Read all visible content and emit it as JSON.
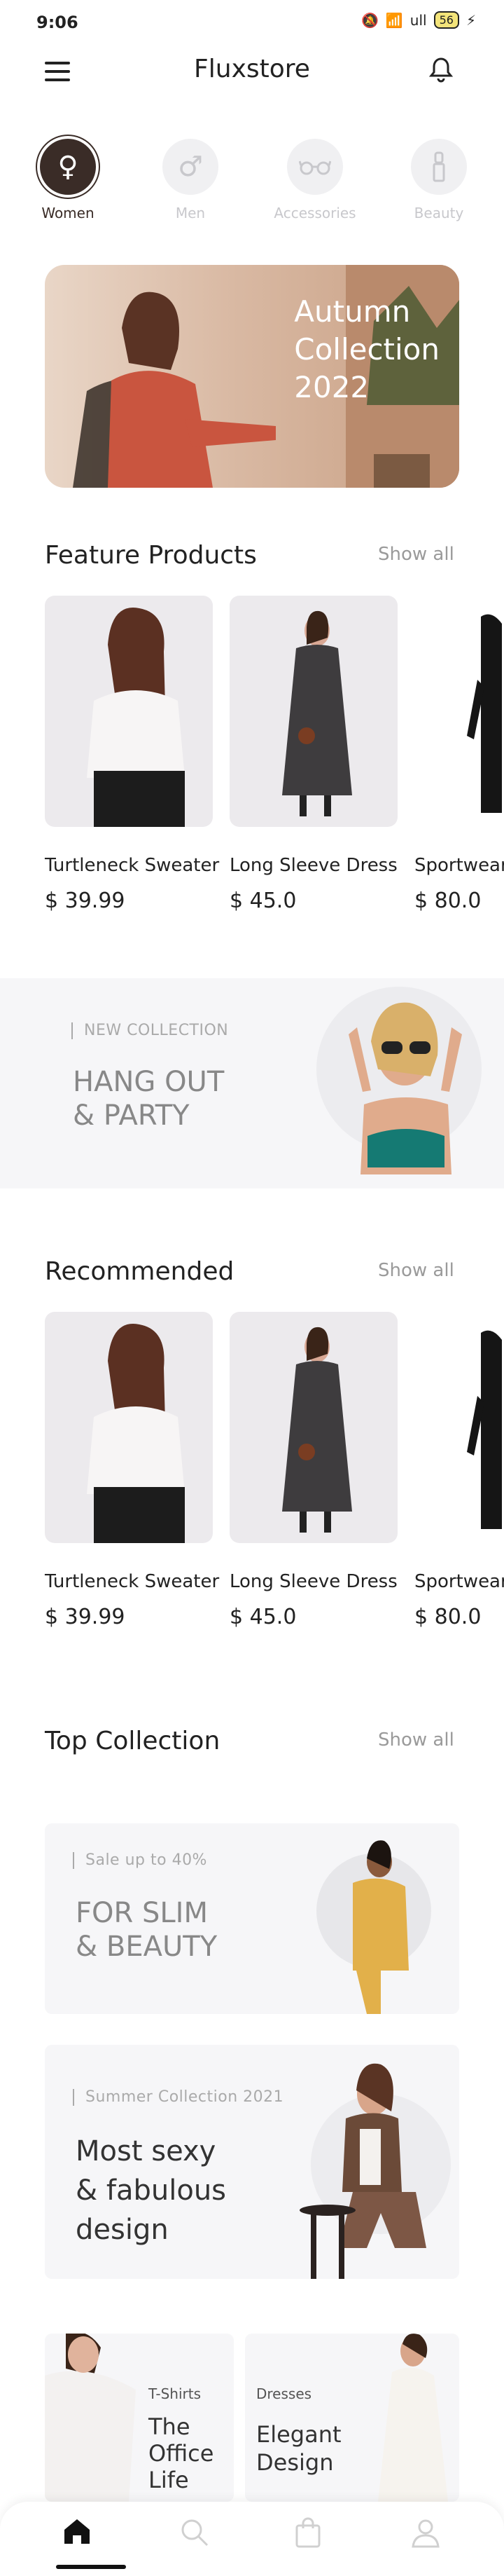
{
  "status_bar": {
    "time": "9:06",
    "battery": "56",
    "signal": "ull"
  },
  "header": {
    "title": "Fluxstore"
  },
  "categories": [
    {
      "label": "Women",
      "icon": "female-icon",
      "glyph": "♀",
      "active": true
    },
    {
      "label": "Men",
      "icon": "male-icon",
      "glyph": "♂",
      "active": false
    },
    {
      "label": "Accessories",
      "icon": "glasses-icon",
      "glyph": "👓",
      "active": false
    },
    {
      "label": "Beauty",
      "icon": "lipstick-icon",
      "glyph": "💄",
      "active": false
    }
  ],
  "banner": {
    "line1": "Autumn",
    "line2": "Collection",
    "line3": "2022"
  },
  "featured": {
    "title": "Feature Products",
    "show_all": "Show all",
    "items": [
      {
        "name": "Turtleneck Sweater",
        "price": "$ 39.99"
      },
      {
        "name": "Long Sleeve Dress",
        "price": "$ 45.0"
      },
      {
        "name": "Sportwear",
        "price": "$ 80.0"
      }
    ]
  },
  "promo": {
    "tag": "NEW COLLECTION",
    "line1": "HANG OUT",
    "line2": "& PARTY"
  },
  "recommended": {
    "title": "Recommended",
    "show_all": "Show all",
    "items": [
      {
        "name": "Turtleneck Sweater",
        "price": "$ 39.99"
      },
      {
        "name": "Long Sleeve Dress",
        "price": "$ 45.0"
      },
      {
        "name": "Sportwear",
        "price": "$ 80.0"
      }
    ]
  },
  "top_collection": {
    "title": "Top Collection",
    "show_all": "Show all",
    "slim": {
      "tag": "Sale up to 40%",
      "line1": "FOR SLIM",
      "line2": "& BEAUTY"
    },
    "summer": {
      "tag": "Summer Collection 2021",
      "line1": "Most sexy",
      "line2": "& fabulous",
      "line3": "design"
    },
    "tshirts": {
      "tag": "T-Shirts",
      "line1": "The",
      "line2": "Office",
      "line3": "Life"
    },
    "dresses": {
      "tag": "Dresses",
      "line1": "Elegant",
      "line2": "Design"
    }
  },
  "bottom_nav": [
    {
      "icon": "home-icon",
      "active": true
    },
    {
      "icon": "search-icon",
      "active": false
    },
    {
      "icon": "shopping-bag-icon",
      "active": false
    },
    {
      "icon": "profile-icon",
      "active": false
    }
  ],
  "colors": {
    "accent": "#3a2c27",
    "muted": "#9a9a9a",
    "card_bg": "#eceaed",
    "promo_bg": "#f6f6f8"
  }
}
